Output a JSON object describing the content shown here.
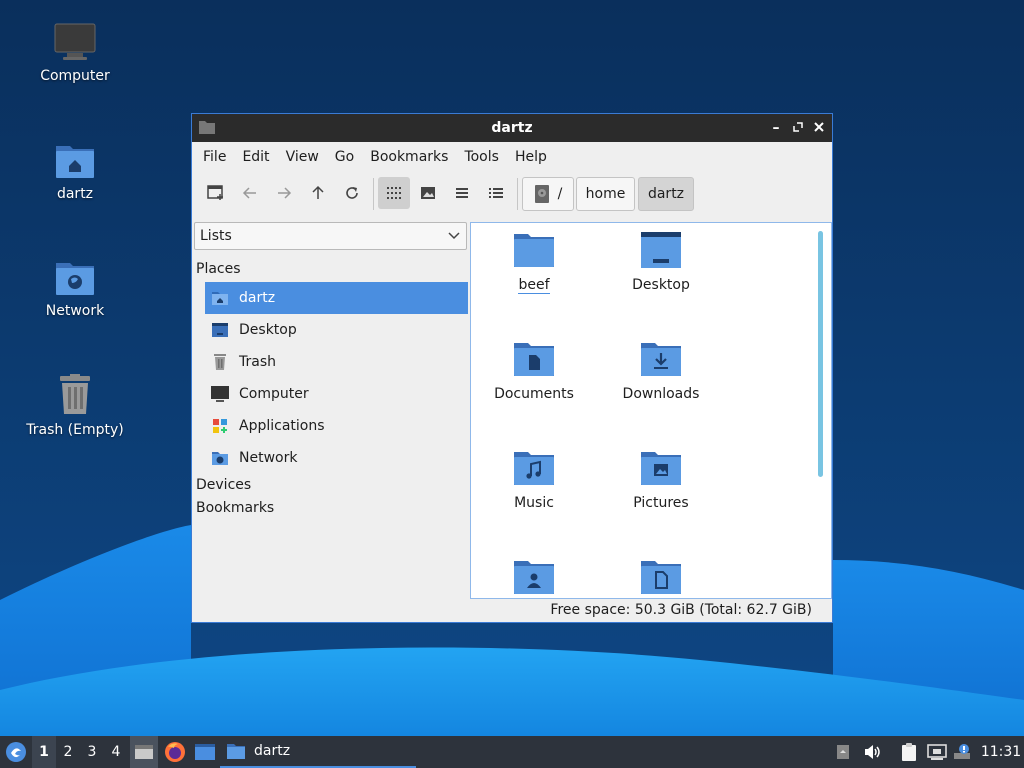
{
  "colors": {
    "accent": "#4a8ee0",
    "folder_blue": "#5b9be3",
    "folder_dark": "#3a6fb8",
    "titlebar": "#2b2b2b",
    "taskbar": "#2d333c"
  },
  "desktop": {
    "icons": [
      {
        "label": "Computer",
        "icon": "computer-icon"
      },
      {
        "label": "dartz",
        "icon": "home-folder-icon"
      },
      {
        "label": "Network",
        "icon": "network-folder-icon"
      },
      {
        "label": "Trash (Empty)",
        "icon": "trash-icon"
      }
    ]
  },
  "window": {
    "title": "dartz",
    "menu": [
      "File",
      "Edit",
      "View",
      "Go",
      "Bookmarks",
      "Tools",
      "Help"
    ],
    "toolbar": {
      "buttons": [
        "new-window-icon",
        "back-arrow-icon",
        "forward-arrow-icon",
        "up-arrow-icon",
        "reload-icon",
        "icon-view-icon",
        "thumbnail-view-icon",
        "compact-view-icon",
        "detailed-list-view-icon"
      ],
      "breadcrumb": [
        "/",
        "home",
        "dartz"
      ]
    },
    "sidepane": {
      "mode": "Lists",
      "places_header": "Places",
      "places": [
        {
          "label": "dartz",
          "icon": "home-folder-icon",
          "selected": true
        },
        {
          "label": "Desktop",
          "icon": "desktop-icon"
        },
        {
          "label": "Trash",
          "icon": "trash-icon"
        },
        {
          "label": "Computer",
          "icon": "computer-icon"
        },
        {
          "label": "Applications",
          "icon": "applications-icon"
        },
        {
          "label": "Network",
          "icon": "network-folder-icon"
        }
      ],
      "devices_header": "Devices",
      "bookmarks_header": "Bookmarks"
    },
    "files": [
      {
        "label": "beef",
        "icon": "folder-icon"
      },
      {
        "label": "Desktop",
        "icon": "desktop-folder-icon"
      },
      {
        "label": "Documents",
        "icon": "documents-folder-icon"
      },
      {
        "label": "Downloads",
        "icon": "downloads-folder-icon"
      },
      {
        "label": "Music",
        "icon": "music-folder-icon"
      },
      {
        "label": "Pictures",
        "icon": "pictures-folder-icon"
      },
      {
        "label": "",
        "icon": "public-folder-icon"
      },
      {
        "label": "",
        "icon": "templates-folder-icon"
      }
    ],
    "status": "Free space: 50.3 GiB (Total: 62.7 GiB)"
  },
  "taskbar": {
    "workspaces": [
      "1",
      "2",
      "3",
      "4"
    ],
    "active_workspace": "1",
    "task_label": "dartz",
    "clock": "11:31"
  }
}
